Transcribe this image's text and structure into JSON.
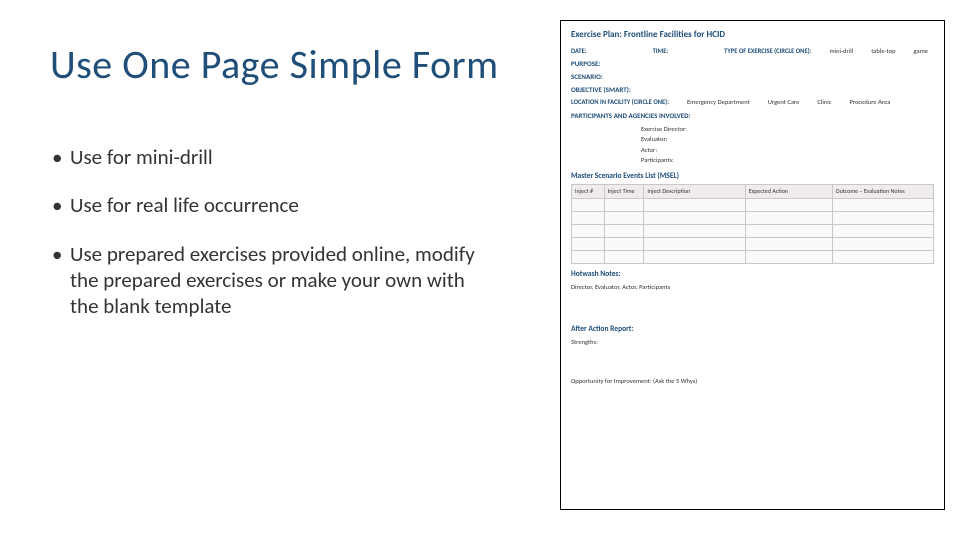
{
  "title": "Use One Page Simple Form",
  "bullets": [
    "Use for mini-drill",
    "Use for real life occurrence",
    "Use prepared exercises provided online, modify the prepared exercises or make your own with the blank template"
  ],
  "form": {
    "title": "Exercise Plan: Frontline Facilities for HCID",
    "date_label": "DATE:",
    "time_label": "TIME:",
    "type_label": "TYPE OF EXERCISE (CIRCLE ONE):",
    "type_options": [
      "mini-drill",
      "table-top",
      "game"
    ],
    "purpose_label": "PURPOSE:",
    "scenario_label": "SCENARIO:",
    "objective_label": "OBJECTIVE (SMART):",
    "location_label": "LOCATION IN FACILITY (CIRCLE ONE):",
    "location_options": [
      "Emergency Department",
      "Urgent Care",
      "Clinic",
      "Procedure Area"
    ],
    "participants_label": "PARTICIPANTS AND AGENCIES INVOLVED:",
    "roles": [
      "Exercise Director:",
      "Evaluator:",
      "Actor:",
      "Participants:"
    ],
    "msel_heading": "Master Scenario Events List (MSEL)",
    "msel_cols": [
      "Inject #",
      "Inject Time",
      "Inject Description",
      "Expected Action",
      "Outcome – Evaluation Notes"
    ],
    "hotwash_heading": "Hotwash Notes:",
    "hotwash_sub": "Director, Evaluator, Actor, Participants",
    "aar_heading": "After Action Report:",
    "aar_strengths": "Strengths:",
    "aar_opportunity": "Opportunity for Improvement: (Ask the 5 Whys)"
  }
}
